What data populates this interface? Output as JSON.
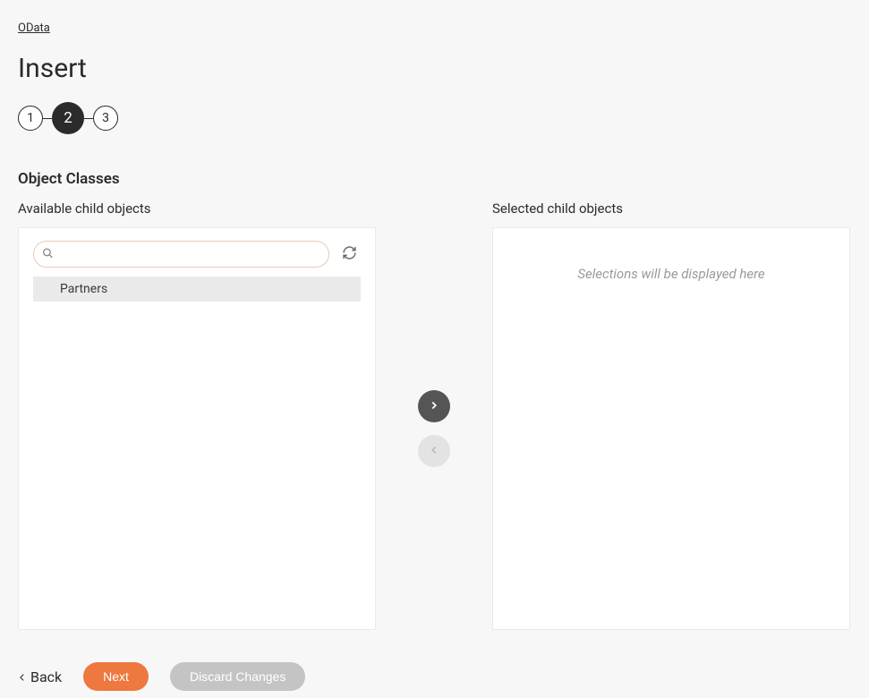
{
  "breadcrumb": "OData",
  "page_title": "Insert",
  "stepper": {
    "steps": [
      "1",
      "2",
      "3"
    ],
    "active_index": 1
  },
  "section_title": "Object Classes",
  "available": {
    "label": "Available child objects",
    "search_value": "",
    "search_placeholder": "",
    "items": [
      {
        "label": "Partners",
        "highlight": true
      }
    ]
  },
  "selected": {
    "label": "Selected child objects",
    "placeholder": "Selections will be displayed here",
    "items": []
  },
  "transfer": {
    "add_enabled": true,
    "remove_enabled": false
  },
  "footer": {
    "back": "Back",
    "next": "Next",
    "discard": "Discard Changes"
  }
}
